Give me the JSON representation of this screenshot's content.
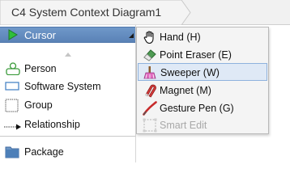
{
  "tab": {
    "title": "C4 System Context Diagram1"
  },
  "palette": {
    "cursor_label": "Cursor",
    "items": [
      {
        "label": "Person",
        "icon": "person-icon"
      },
      {
        "label": "Software System",
        "icon": "software-system-icon"
      },
      {
        "label": "Group",
        "icon": "group-icon"
      },
      {
        "label": "Relationship",
        "icon": "relationship-icon"
      },
      {
        "label": "Package",
        "icon": "package-icon"
      }
    ]
  },
  "tool_menu": {
    "items": [
      {
        "label": "Hand (H)",
        "icon": "hand-icon",
        "selected": false,
        "enabled": true
      },
      {
        "label": "Point Eraser (E)",
        "icon": "eraser-icon",
        "selected": false,
        "enabled": true
      },
      {
        "label": "Sweeper (W)",
        "icon": "sweeper-icon",
        "selected": true,
        "enabled": true
      },
      {
        "label": "Magnet (M)",
        "icon": "magnet-icon",
        "selected": false,
        "enabled": true
      },
      {
        "label": "Gesture Pen (G)",
        "icon": "gesture-pen-icon",
        "selected": false,
        "enabled": true
      },
      {
        "label": "Smart Edit",
        "icon": "smart-edit-icon",
        "selected": false,
        "enabled": false
      }
    ]
  },
  "colors": {
    "selection_bg": "#dfe9f6",
    "selection_border": "#8eb2dd",
    "cursor_row_bg": "#6f98c9",
    "person_green": "#3a9a3a",
    "software_blue": "#4a86c5"
  }
}
